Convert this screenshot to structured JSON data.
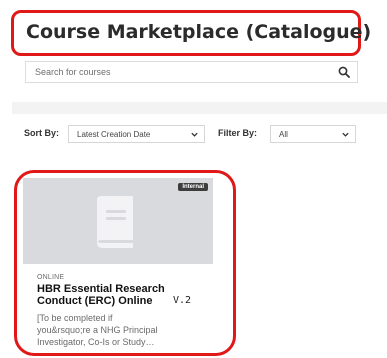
{
  "page": {
    "title": "Course Marketplace (Catalogue)"
  },
  "search": {
    "placeholder": "Search for courses",
    "value": ""
  },
  "filters": {
    "sort_label": "Sort By:",
    "sort_value": "Latest Creation Date",
    "filter_label": "Filter By:",
    "filter_value": "All"
  },
  "courses": [
    {
      "badge": "Internal",
      "type": "ONLINE",
      "title": "HBR Essential Research Conduct (ERC) Online",
      "version": "V.2",
      "description_line1": "[To be completed if",
      "description_line2": "you&rsquo;re a NHG Principal",
      "description_line3": "Investigator, Co-Is or Study…"
    }
  ],
  "colors": {
    "highlight": "#e01818",
    "thumbnail_bg": "#d9dade",
    "badge_bg": "#3d3d3d"
  }
}
